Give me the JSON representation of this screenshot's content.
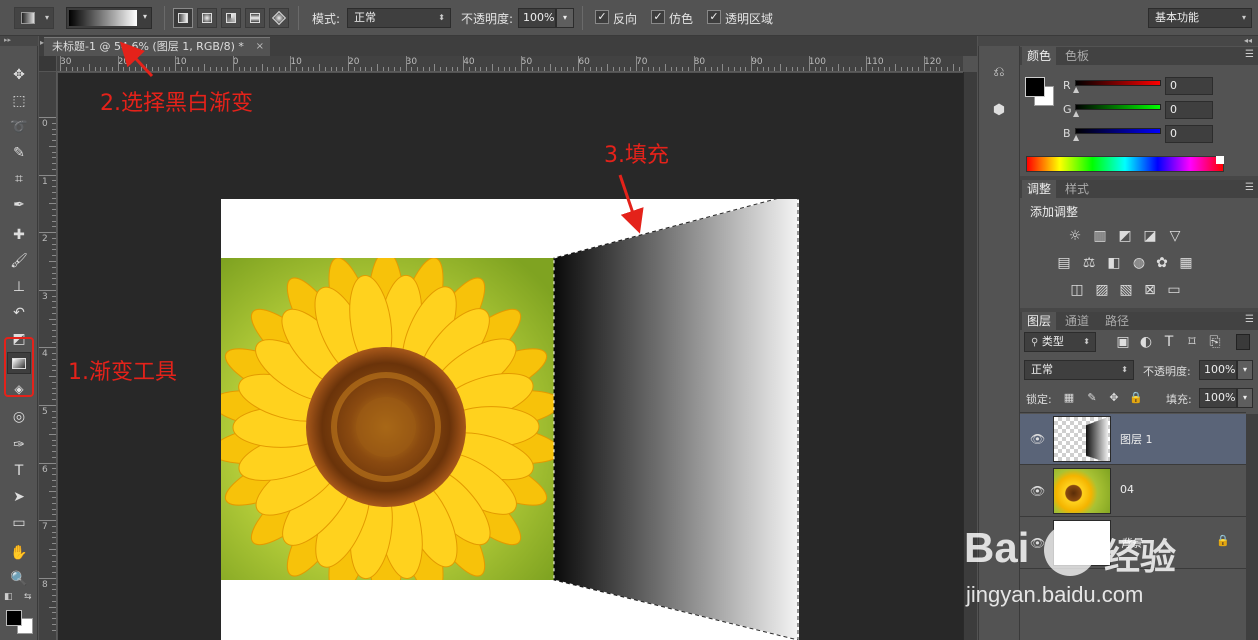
{
  "options_bar": {
    "mode_label": "模式:",
    "mode_value": "正常",
    "opacity_label": "不透明度:",
    "opacity_value": "100%",
    "reverse_label": "反向",
    "dither_label": "仿色",
    "transparency_label": "透明区域",
    "workspace_value": "基本功能"
  },
  "document": {
    "tab_title": "未标题-1 @ 54.6% (图层 1, RGB/8) *",
    "close": "×",
    "ruler_top_labels": [
      "30",
      "20",
      "10",
      "0",
      "10",
      "20",
      "30",
      "40",
      "50",
      "60",
      "70",
      "80",
      "90",
      "100",
      "110",
      "120"
    ],
    "ruler_left_labels": [
      "0",
      "1",
      "2",
      "3",
      "4",
      "5",
      "6",
      "7",
      "8"
    ]
  },
  "annotations": {
    "step1": "1.渐变工具",
    "step2": "2.选择黑白渐变",
    "step3": "3.填充"
  },
  "color_panel": {
    "tab_color": "颜色",
    "tab_swatches": "色板",
    "r_label": "R",
    "g_label": "G",
    "b_label": "B",
    "r_value": "0",
    "g_value": "0",
    "b_value": "0"
  },
  "adjustments_panel": {
    "tab_adjust": "调整",
    "tab_styles": "样式",
    "heading": "添加调整"
  },
  "layers_panel": {
    "tab_layers": "图层",
    "tab_channels": "通道",
    "tab_paths": "路径",
    "filter_kind": "类型",
    "blend_mode": "正常",
    "opacity_label": "不透明度:",
    "opacity_value": "100%",
    "lock_label": "锁定:",
    "fill_label": "填充:",
    "fill_value": "100%",
    "layers": [
      {
        "name": "图层 1",
        "selected": true
      },
      {
        "name": "04",
        "selected": false
      },
      {
        "name": "背景",
        "selected": false
      }
    ]
  },
  "watermark": {
    "brand_latin": "Bai",
    "brand_cn": "经验",
    "url": "jingyan.baidu.com"
  },
  "colors": {
    "annotation_red": "#e4221a",
    "selected_layer": "#5a6478",
    "panel_bg": "#535353",
    "canvas_bg": "#282828"
  }
}
